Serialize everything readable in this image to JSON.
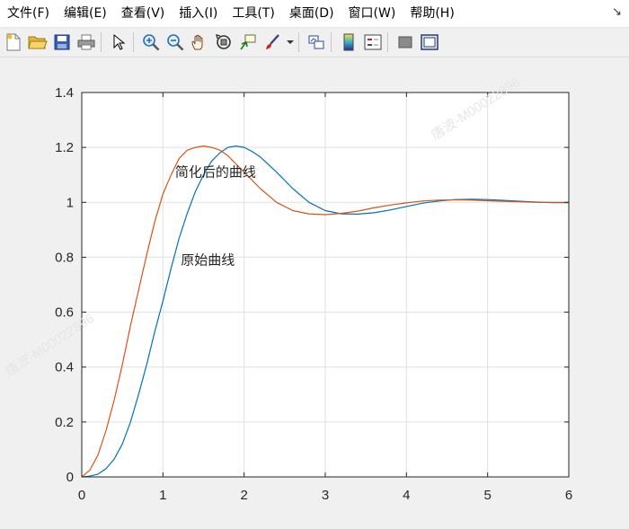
{
  "menu": {
    "items": [
      "文件(F)",
      "编辑(E)",
      "查看(V)",
      "插入(I)",
      "工具(T)",
      "桌面(D)",
      "窗口(W)",
      "帮助(H)"
    ],
    "arrow": "↘"
  },
  "toolbar": {
    "buttons": [
      "new-file-icon",
      "open-folder-icon",
      "save-icon",
      "print-icon",
      "select-arrow-icon",
      "zoom-in-icon",
      "zoom-out-icon",
      "pan-hand-icon",
      "rotate-3d-icon",
      "data-cursor-icon",
      "brush-icon",
      "brush-dropdown-icon",
      "link-plot-icon",
      "colorbar-icon",
      "legend-icon",
      "hide-plot-tools-icon",
      "show-plot-tools-icon"
    ]
  },
  "watermarks": [
    "唐波-M00022896",
    "唐波-M00022896"
  ],
  "colors": {
    "original": "#0072bd",
    "simplified": "#d95319"
  },
  "chart_data": {
    "type": "line",
    "xlim": [
      0,
      6
    ],
    "ylim": [
      0,
      1.4
    ],
    "xticks": [
      0,
      1,
      2,
      3,
      4,
      5,
      6
    ],
    "yticks": [
      0,
      0.2,
      0.4,
      0.6,
      0.8,
      1,
      1.2,
      1.4
    ],
    "xtick_labels": [
      "0",
      "1",
      "2",
      "3",
      "4",
      "5",
      "6"
    ],
    "ytick_labels": [
      "0",
      "0.2",
      "0.4",
      "0.6",
      "0.8",
      "1",
      "1.2",
      "1.4"
    ],
    "grid": true,
    "annotations": [
      {
        "text": "简化后的曲线",
        "x": 1.15,
        "y": 1.11
      },
      {
        "text": "原始曲线",
        "x": 1.22,
        "y": 0.79
      }
    ],
    "series": [
      {
        "color": "#0072bd",
        "x": [
          0,
          0.1,
          0.2,
          0.3,
          0.4,
          0.5,
          0.6,
          0.7,
          0.8,
          0.9,
          1.0,
          1.1,
          1.2,
          1.3,
          1.4,
          1.5,
          1.6,
          1.7,
          1.8,
          1.9,
          2.0,
          2.1,
          2.2,
          2.4,
          2.6,
          2.8,
          3.0,
          3.2,
          3.4,
          3.6,
          3.8,
          4.0,
          4.2,
          4.4,
          4.6,
          4.8,
          5.0,
          5.2,
          5.4,
          5.6,
          5.8,
          6.0
        ],
        "y": [
          0,
          0.003,
          0.01,
          0.03,
          0.065,
          0.12,
          0.2,
          0.3,
          0.41,
          0.53,
          0.64,
          0.76,
          0.87,
          0.96,
          1.04,
          1.1,
          1.15,
          1.18,
          1.2,
          1.205,
          1.2,
          1.185,
          1.165,
          1.11,
          1.05,
          1.0,
          0.97,
          0.958,
          0.957,
          0.962,
          0.972,
          0.985,
          0.997,
          1.005,
          1.01,
          1.011,
          1.01,
          1.007,
          1.004,
          1.001,
          0.999,
          0.999
        ]
      },
      {
        "color": "#d95319",
        "x": [
          0,
          0.1,
          0.2,
          0.3,
          0.4,
          0.5,
          0.6,
          0.7,
          0.8,
          0.9,
          1.0,
          1.1,
          1.2,
          1.3,
          1.4,
          1.5,
          1.6,
          1.7,
          1.8,
          1.9,
          2.0,
          2.2,
          2.4,
          2.6,
          2.8,
          3.0,
          3.2,
          3.4,
          3.6,
          3.8,
          4.0,
          4.2,
          4.4,
          4.6,
          4.8,
          5.0,
          5.2,
          5.4,
          5.6,
          5.8,
          6.0
        ],
        "y": [
          0,
          0.025,
          0.08,
          0.17,
          0.28,
          0.41,
          0.55,
          0.68,
          0.81,
          0.93,
          1.03,
          1.1,
          1.16,
          1.19,
          1.2,
          1.205,
          1.2,
          1.19,
          1.17,
          1.14,
          1.11,
          1.05,
          1.0,
          0.97,
          0.958,
          0.955,
          0.96,
          0.968,
          0.98,
          0.99,
          0.998,
          1.005,
          1.008,
          1.009,
          1.008,
          1.006,
          1.004,
          1.002,
          1.0,
          1.0,
          1.0
        ]
      }
    ]
  }
}
